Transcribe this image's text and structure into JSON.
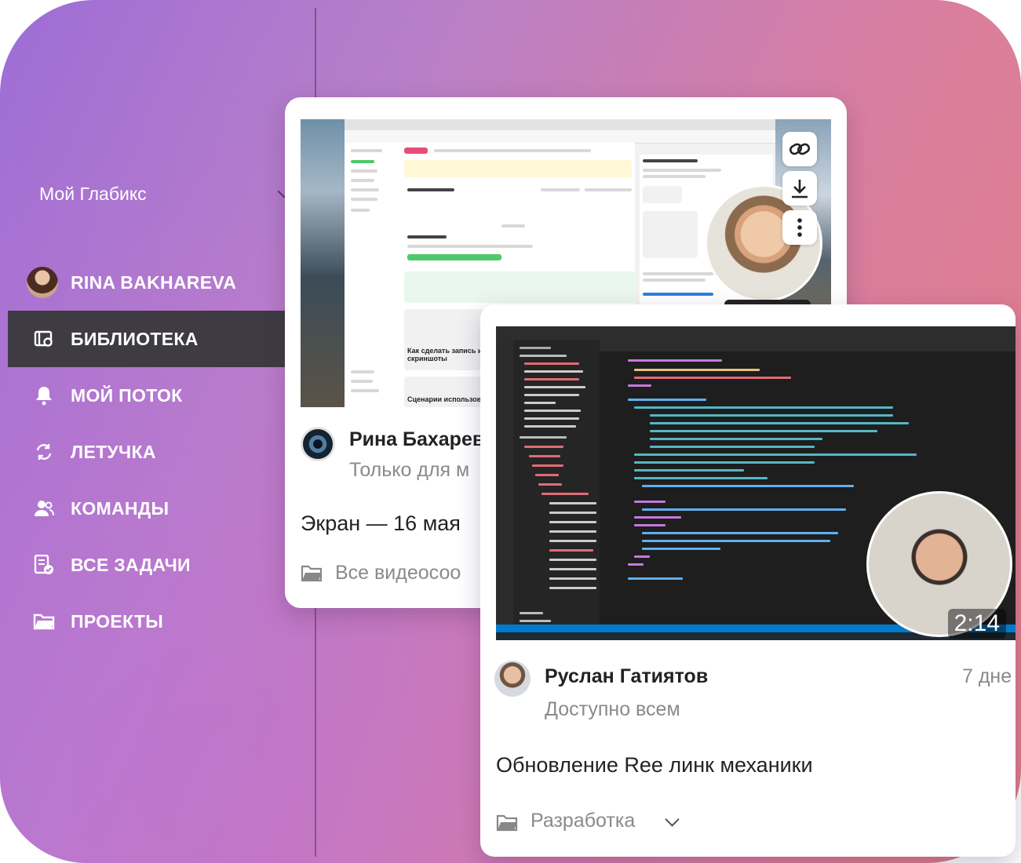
{
  "workspace": {
    "name": "Мой Глабикс"
  },
  "nav": {
    "user": "RINA BAKHAREVA",
    "items": [
      {
        "label": "БИБЛИОТЕКА",
        "icon": "library-icon",
        "active": true
      },
      {
        "label": "МОЙ ПОТОК",
        "icon": "bell-icon"
      },
      {
        "label": "ЛЕТУЧКА",
        "icon": "refresh-icon"
      },
      {
        "label": "КОМАНДЫ",
        "icon": "users-icon"
      },
      {
        "label": "ВСЕ ЗАДАЧИ",
        "icon": "tasks-icon"
      },
      {
        "label": "ПРОЕКТЫ",
        "icon": "folder-icon"
      }
    ]
  },
  "cards": [
    {
      "author": "Рина Бахарев",
      "access": "Только для м",
      "title": "Экран — 16 мая",
      "folder": "Все видеосоо",
      "preview": {
        "thumb_a": "Как сделать запись и скриншоты",
        "thumb_b": "Сценарии использования"
      }
    },
    {
      "author": "Руслан Гатиятов",
      "time": "7 дне",
      "access": "Доступно всем",
      "title": "Обновление Ree линк механики",
      "folder": "Разработка",
      "duration": "2:14"
    }
  ],
  "colors": {
    "gradient_start": "#9e6dd6",
    "gradient_end": "#e17c83",
    "active_nav": "#3e3b42",
    "vscode_status": "#007acc"
  }
}
